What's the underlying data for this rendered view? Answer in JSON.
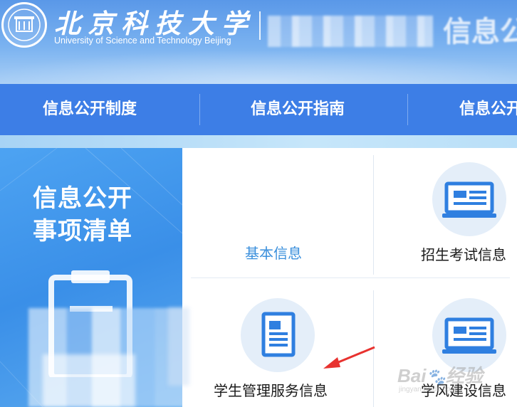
{
  "header": {
    "university_cn": "北京科技大学",
    "university_en": "University of Science and Technology Beijing",
    "site_title_partial": "信息公"
  },
  "nav": {
    "items": [
      {
        "label": "信息公开制度"
      },
      {
        "label": "信息公开指南"
      },
      {
        "label": "信息公开"
      }
    ]
  },
  "sidebar": {
    "title_line1": "信息公开",
    "title_line2": "事项清单"
  },
  "cards": [
    {
      "label": "基本信息",
      "state": "active"
    },
    {
      "label": "招生考试信息",
      "icon": "monitor-icon"
    },
    {
      "label": "学生管理服务信息",
      "icon": "document-icon"
    },
    {
      "label": "学风建设信息",
      "icon": "monitor-icon"
    }
  ],
  "watermark": {
    "brand": "Bai",
    "brand2": "经验",
    "url": "jingyan.baidu.com"
  },
  "colors": {
    "nav_bg": "#3d7ee6",
    "header_bg": "#5a98e8",
    "side_panel": "#3a8fe8",
    "active_label": "#3a8fdc",
    "icon_blue": "#2f7fe0",
    "arrow_red": "#e8322f"
  }
}
